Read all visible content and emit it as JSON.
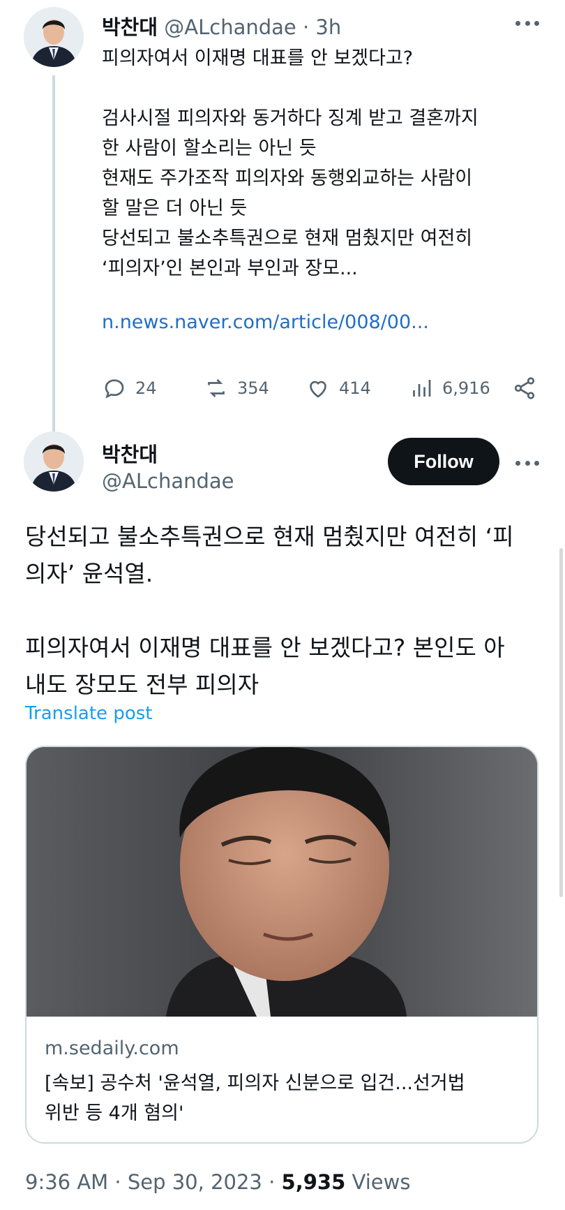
{
  "thread_tweet": {
    "author_name": "박찬대",
    "handle": "@ALchandae",
    "separator": " · ",
    "time": "3h",
    "body": "피의자여서 이재명 대표를 안 보겠다고?\n\n검사시절 피의자와 동거하다 징계 받고 결혼까지\n한 사람이 할소리는 아닌 듯\n현재도 주가조작 피의자와 동행외교하는 사람이\n할 말은 더 아닌 듯\n당선되고 불소추특권으로 현재 멈췄지만 여전히\n‘피의자’인 본인과 부인과 장모...",
    "link": "n.news.naver.com/article/008/00...",
    "replies": "24",
    "reposts": "354",
    "likes": "414",
    "views": "6,916"
  },
  "main_tweet": {
    "author_name": "박찬대",
    "handle": "@ALchandae",
    "follow_label": "Follow",
    "text": "당선되고 불소추특권으로 현재 멈췄지만 여전히 ‘피\n의자’ 윤석열.\n\n피의자여서 이재명 대표를 안 보겠다고? 본인도 아\n내도 장모도 전부 피의자",
    "translate_label": "Translate post",
    "card": {
      "domain": "m.sedaily.com",
      "title": "[속보] 공수처 '윤석열, 피의자 신분으로 입건...선거법\n위반 등 4개 혐의'"
    },
    "time": "9:36 AM",
    "dot": " · ",
    "date": "Sep 30, 2023",
    "views_count": "5,935",
    "views_label": " Views"
  },
  "icons": {
    "reply": "reply-icon",
    "repost": "repost-icon",
    "like": "like-icon",
    "views": "views-icon",
    "share": "share-icon",
    "more": "more-icon"
  },
  "colors": {
    "text": "#0f1419",
    "muted": "#536471",
    "link": "#1d6fc6",
    "translate": "#1d9bf0",
    "follow_bg": "#0f1419"
  }
}
